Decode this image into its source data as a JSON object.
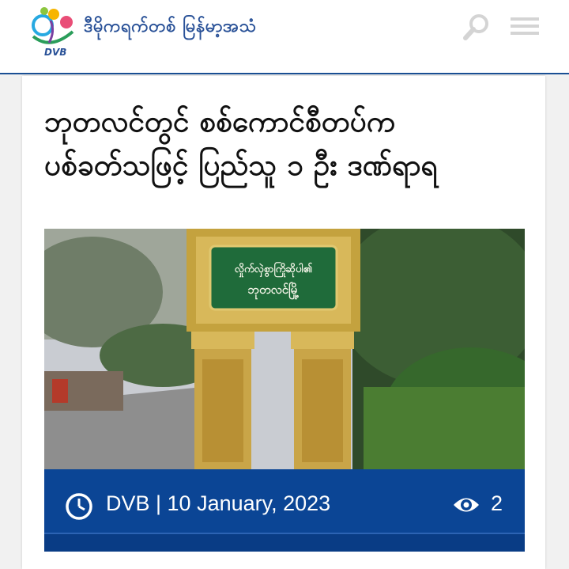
{
  "header": {
    "brand_name": "ဒီမိုကရက်တစ် မြန်မာ့အသံ",
    "logo_text": "DVB",
    "search_icon": "search-icon",
    "menu_icon": "hamburger-menu-icon",
    "accent_color": "#1a4f94"
  },
  "article": {
    "title_line1": "ဘုတလင်တွင် စစ်ကောင်စီတပ်က",
    "title_line2": "ပစ်ခတ်သဖြင့် ပြည်သူ ၁ ဦး ဒဏ်ရာရ",
    "image_sign_line1": "လှိုက်လှဲစွာကြိုဆိုပါ၏",
    "image_sign_line2": "ဘုတလင်မြို့",
    "meta": {
      "byline": "DVB | 10 January, 2023",
      "views": "2",
      "clock_icon": "clock-icon",
      "views_icon": "eye-icon",
      "bar_color": "#0b4595"
    }
  }
}
